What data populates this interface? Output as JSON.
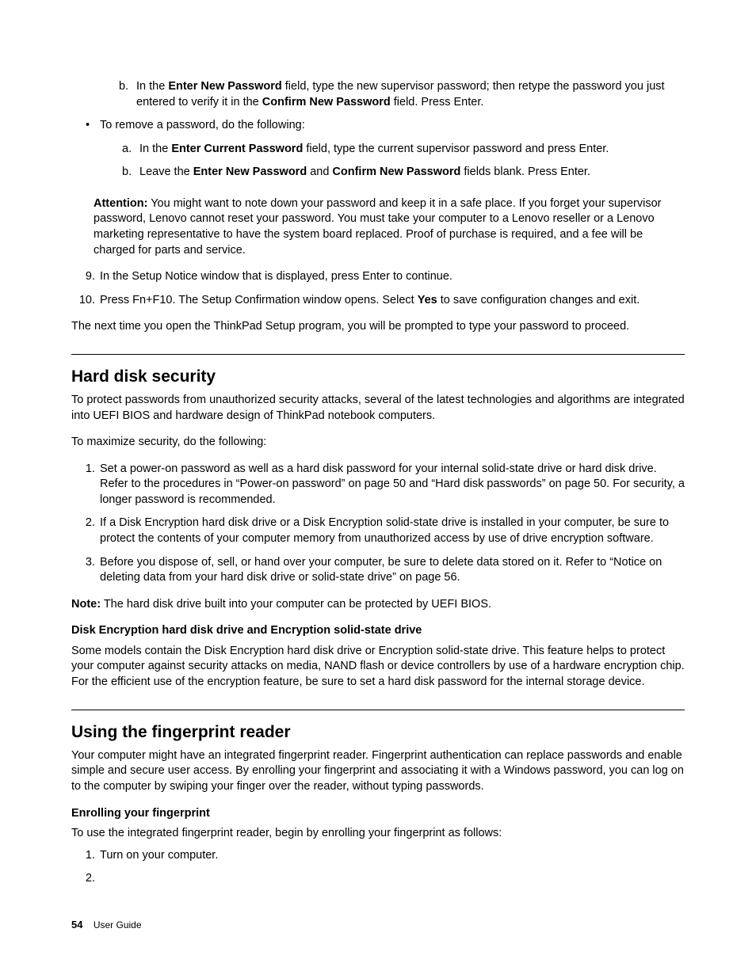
{
  "sub_b": {
    "b_marker": "b.",
    "b_pre": "In the ",
    "b_bold1": "Enter New Password",
    "b_mid": " field, type the new supervisor password; then retype the password you just entered to verify it in the ",
    "b_bold2": "Confirm New Password",
    "b_post": " field.  Press Enter."
  },
  "bullet_remove": {
    "text": "To remove a password, do the following:",
    "a_marker": "a.",
    "a_pre": "In the ",
    "a_bold": "Enter Current Password",
    "a_post": " field, type the current supervisor password and press Enter.",
    "b_marker": "b.",
    "b_pre": "Leave the ",
    "b_bold1": "Enter New Password",
    "b_mid": " and ",
    "b_bold2": "Confirm New Password",
    "b_post": " fields blank.  Press Enter."
  },
  "attention": {
    "label": "Attention:",
    "text": " You might want to note down your password and keep it in a safe place.  If you forget your supervisor password, Lenovo cannot reset your password.  You must take your computer to a Lenovo reseller or a Lenovo marketing representative to have the system board replaced.  Proof of purchase is required, and a fee will be charged for parts and service."
  },
  "step9": {
    "marker": "9.",
    "text": "In the Setup Notice window that is displayed, press Enter to continue."
  },
  "step10": {
    "marker": "10.",
    "pre": "Press Fn+F10.  The Setup Confirmation window opens.  Select ",
    "bold": "Yes",
    "post": " to save configuration changes and exit."
  },
  "after_steps": "The next time you open the ThinkPad Setup program, you will be prompted to type your password to proceed.",
  "hdd": {
    "heading": "Hard disk security",
    "intro": "To protect passwords from unauthorized security attacks, several of the latest technologies and algorithms are integrated into UEFI BIOS and hardware design of ThinkPad notebook computers.",
    "maximize": "To maximize security, do the following:",
    "s1_marker": "1.",
    "s1": "Set a power-on password as well as a hard disk password for your internal solid-state drive or hard disk drive.  Refer to the procedures in “Power-on password” on page 50 and “Hard disk passwords” on page 50.  For security, a longer password is recommended.",
    "s2_marker": "2.",
    "s2": "If a Disk Encryption hard disk drive or a Disk Encryption solid-state drive is installed in your computer, be sure to protect the contents of your computer memory from unauthorized access by use of drive encryption software.",
    "s3_marker": "3.",
    "s3": "Before you dispose of, sell, or hand over your computer, be sure to delete data stored on it.  Refer to “Notice on deleting data from your hard disk drive or solid-state drive” on page 56.",
    "note_label": "Note:",
    "note_text": " The hard disk drive built into your computer can be protected by UEFI BIOS.",
    "subhead": "Disk Encryption hard disk drive and Encryption solid-state drive",
    "sub_text": "Some models contain the Disk Encryption hard disk drive or Encryption solid-state drive.  This feature helps to protect your computer against security attacks on media, NAND flash or device controllers by use of a hardware encryption chip.  For the efficient use of the encryption feature, be sure to set a hard disk password for the internal storage device."
  },
  "fp": {
    "heading": "Using the fingerprint reader",
    "intro": "Your computer might have an integrated fingerprint reader.  Fingerprint authentication can replace passwords and enable simple and secure user access.  By enrolling your fingerprint and associating it with a Windows password, you can log on to the computer by swiping your finger over the reader, without typing passwords.",
    "subhead": "Enrolling your fingerprint",
    "sub_text": "To use the integrated fingerprint reader, begin by enrolling your fingerprint as follows:",
    "s1_marker": "1.",
    "s1": "Turn on your computer.",
    "s2_marker": "2."
  },
  "footer": {
    "page": "54",
    "title": "User Guide"
  }
}
